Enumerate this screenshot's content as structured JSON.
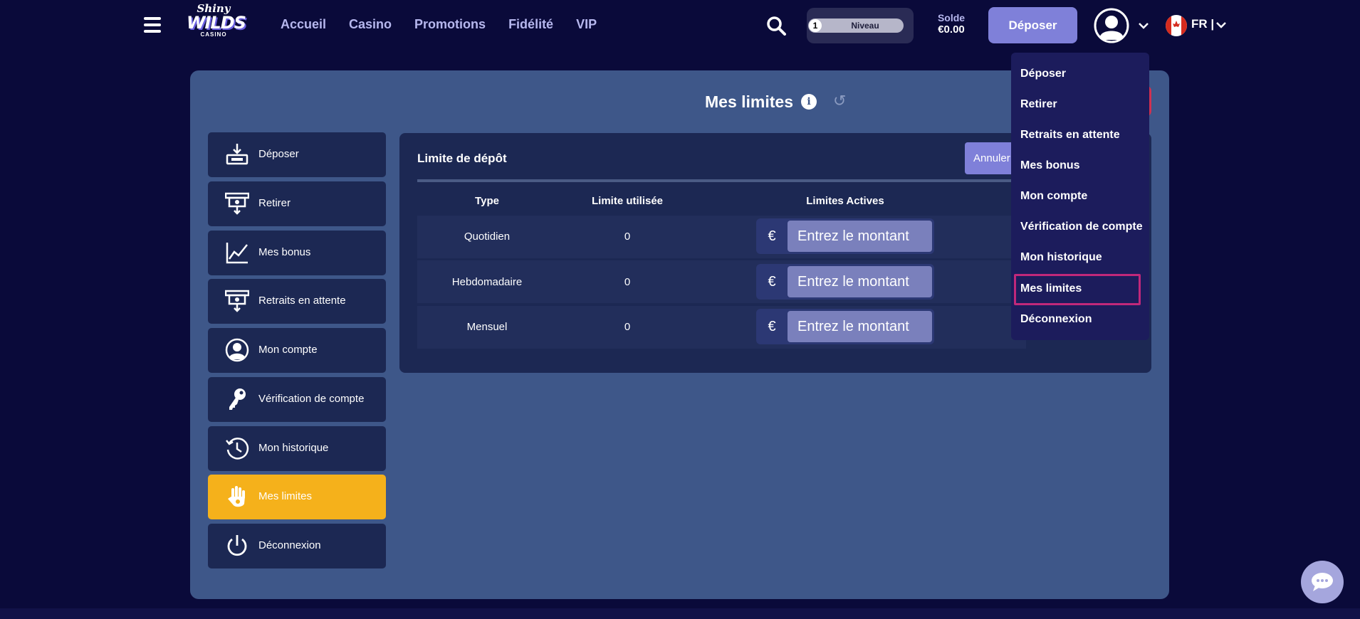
{
  "header": {
    "logo": {
      "line1": "Shiny",
      "line2": "WILDS",
      "line3": "CASINO"
    },
    "nav": [
      "Accueil",
      "Casino",
      "Promotions",
      "Fidélité",
      "VIP"
    ],
    "level": {
      "number": "1",
      "label": "Niveau"
    },
    "balance": {
      "title": "Solde",
      "value": "€0.00"
    },
    "deposit_label": "Déposer",
    "lang": "FR |"
  },
  "page": {
    "title": "Mes limites"
  },
  "sidebar": [
    {
      "label": "Déposer",
      "icon": "deposit-icon"
    },
    {
      "label": "Retirer",
      "icon": "withdraw-icon"
    },
    {
      "label": "Mes bonus",
      "icon": "chart-line-icon"
    },
    {
      "label": "Retraits en attente",
      "icon": "pending-withdraw-icon"
    },
    {
      "label": "Mon compte",
      "icon": "user-circle-icon"
    },
    {
      "label": "Vérification de compte",
      "icon": "key-icon"
    },
    {
      "label": "Mon historique",
      "icon": "history-icon"
    },
    {
      "label": "Mes limites",
      "icon": "hand-icon",
      "active": true
    },
    {
      "label": "Déconnexion",
      "icon": "power-icon"
    }
  ],
  "limits": {
    "title": "Limite de dépôt",
    "cancel_label": "Annuler",
    "columns": [
      "Type",
      "Limite utilisée",
      "Limites Actives"
    ],
    "rows": [
      {
        "type": "Quotidien",
        "used": "0"
      },
      {
        "type": "Hebdomadaire",
        "used": "0"
      },
      {
        "type": "Mensuel",
        "used": "0"
      }
    ],
    "currency": "€",
    "placeholder": "Entrez le montant"
  },
  "dropdown": [
    "Déposer",
    "Retirer",
    "Retraits en attente",
    "Mes bonus",
    "Mon compte",
    "Vérification de compte",
    "Mon historique",
    "Mes limites",
    "Déconnexion"
  ],
  "colors": {
    "accent": "#f5b11b",
    "panel": "#3e5789",
    "highlight": "#c0287a"
  }
}
